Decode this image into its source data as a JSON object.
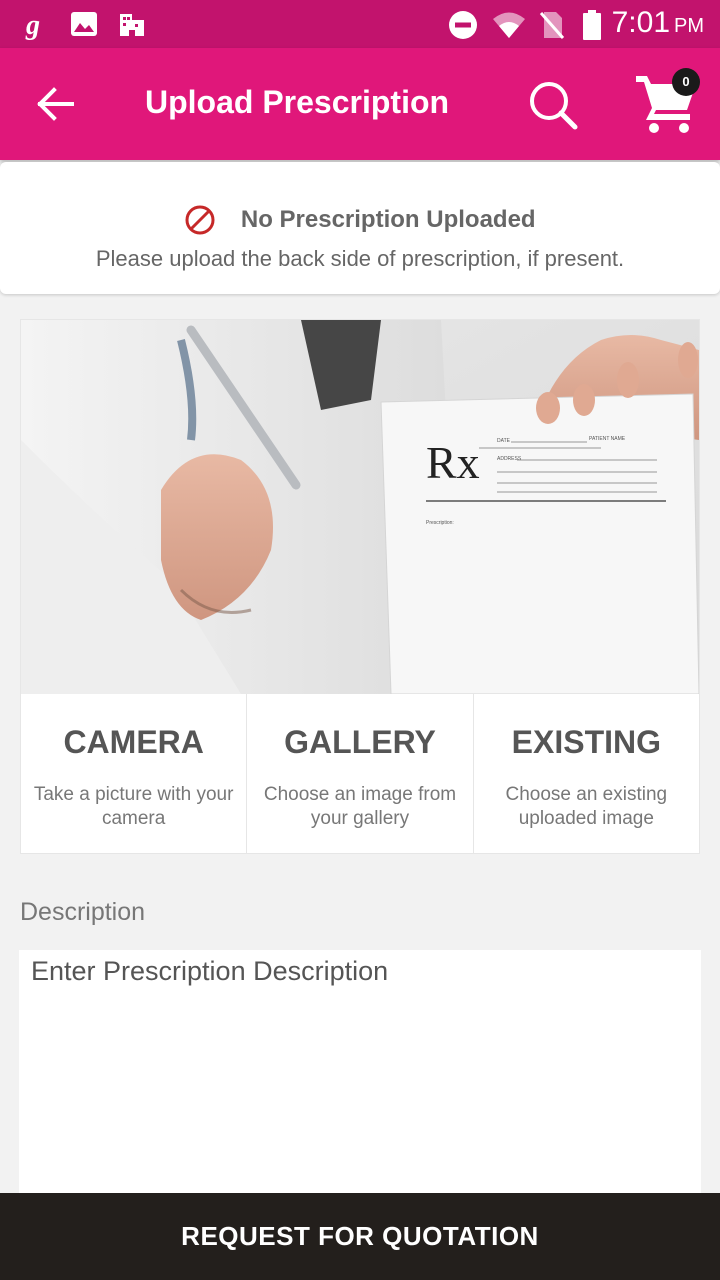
{
  "status_bar": {
    "time": "7:01",
    "ampm": "PM",
    "left_icons": [
      "g-app-icon",
      "image-icon",
      "building-icon"
    ],
    "right_icons": [
      "do-not-disturb-icon",
      "wifi-icon",
      "no-sim-icon",
      "battery-icon"
    ]
  },
  "app_bar": {
    "title": "Upload Prescription",
    "cart_count": "0",
    "color": "#e0177a"
  },
  "status_card": {
    "title": "No Prescription Uploaded",
    "subtitle": "Please upload the back side of prescription, if present."
  },
  "hero": {
    "rx_symbol": "Rx",
    "form_date": "DATE",
    "form_patient": "PATIENT NAME",
    "form_address": "ADDRESS",
    "form_prescription": "Prescription:"
  },
  "options": [
    {
      "title": "CAMERA",
      "desc": "Take a picture with your camera"
    },
    {
      "title": "GALLERY",
      "desc": "Choose an image from your gallery"
    },
    {
      "title": "EXISTING",
      "desc": "Choose an existing uploaded image"
    }
  ],
  "description": {
    "label": "Description",
    "placeholder": "Enter Prescription Description",
    "value": ""
  },
  "cta": {
    "label": "REQUEST FOR QUOTATION"
  }
}
